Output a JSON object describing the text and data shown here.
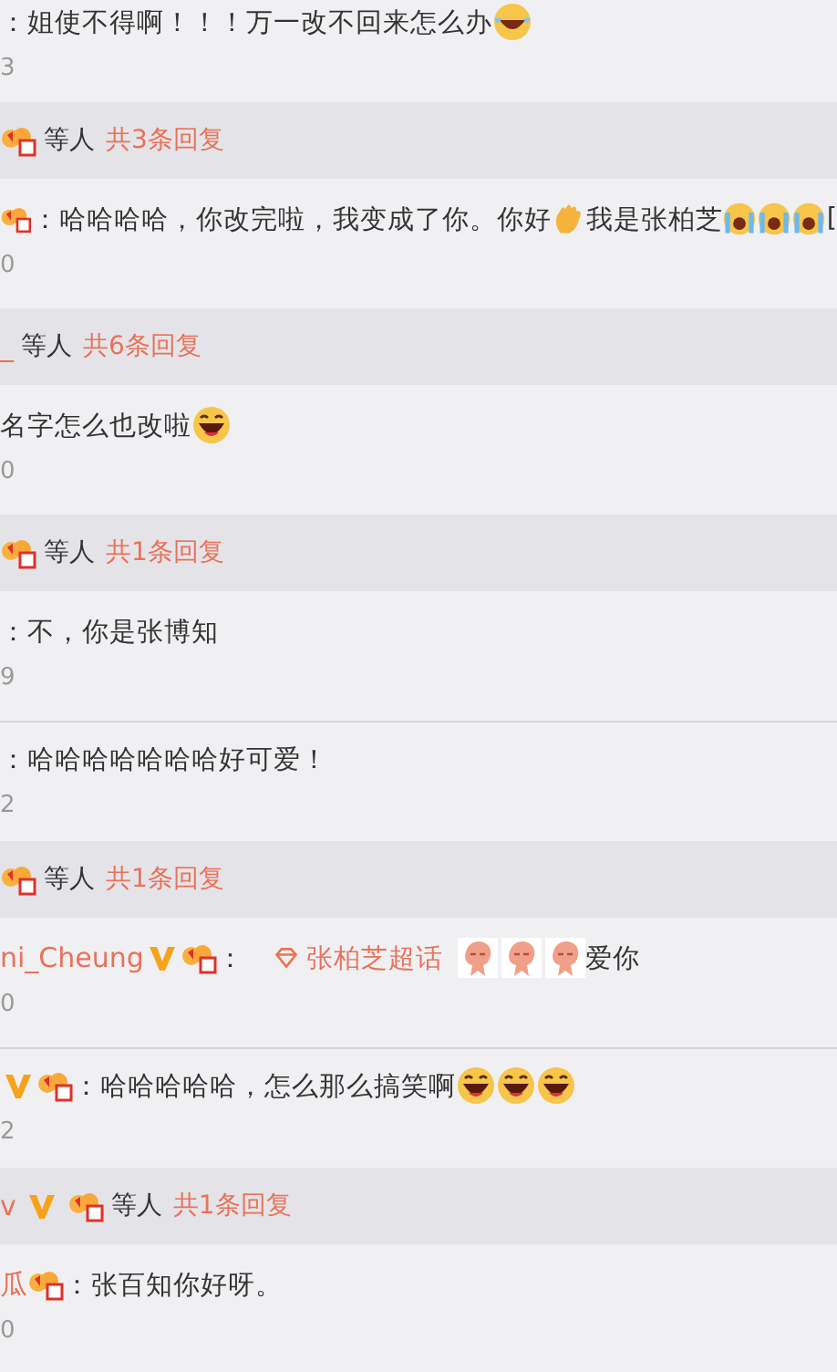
{
  "items": [
    {
      "kind": "comment",
      "segments": [
        {
          "kind": "text",
          "text": "：姐使不得啊！！！万一改不回来怎么办"
        },
        {
          "kind": "tears-emoji"
        }
      ],
      "count": "3"
    },
    {
      "kind": "summary",
      "segments": [
        {
          "kind": "badge"
        }
      ],
      "suffix": "等人",
      "replies": "共3条回复"
    },
    {
      "kind": "comment",
      "segments": [
        {
          "kind": "badge"
        },
        {
          "kind": "text",
          "text": "：哈哈哈哈，你改完啦，我变成了你。你好"
        },
        {
          "kind": "wave-emoji"
        },
        {
          "kind": "text",
          "text": "我是张柏芝"
        },
        {
          "kind": "cry-emoji"
        },
        {
          "kind": "cry-emoji"
        },
        {
          "kind": "cry-emoji"
        },
        {
          "kind": "text",
          "text": "["
        }
      ],
      "count": "0"
    },
    {
      "kind": "summary",
      "segments": [
        {
          "kind": "user",
          "text": "_"
        }
      ],
      "suffix": "等人",
      "replies": "共6条回复"
    },
    {
      "kind": "comment",
      "segments": [
        {
          "kind": "text",
          "text": "名字怎么也改啦"
        },
        {
          "kind": "laugh-emoji"
        }
      ],
      "count": "0"
    },
    {
      "kind": "summary",
      "segments": [
        {
          "kind": "badge"
        }
      ],
      "suffix": "等人",
      "replies": "共1条回复"
    },
    {
      "kind": "comment",
      "segments": [
        {
          "kind": "text",
          "text": "：不，你是张博知"
        }
      ],
      "count": "9"
    },
    {
      "kind": "comment",
      "segments": [
        {
          "kind": "text",
          "text": "：哈哈哈哈哈哈哈好可爱！"
        }
      ],
      "count": "2"
    },
    {
      "kind": "summary",
      "segments": [
        {
          "kind": "badge"
        }
      ],
      "suffix": "等人",
      "replies": "共1条回复"
    },
    {
      "kind": "comment",
      "segments": [
        {
          "kind": "user",
          "text": "ni_Cheung"
        },
        {
          "kind": "vip"
        },
        {
          "kind": "badge"
        },
        {
          "kind": "text",
          "text": "："
        },
        {
          "kind": "link",
          "text": "张柏芝超话"
        },
        {
          "kind": "sticker"
        },
        {
          "kind": "sticker"
        },
        {
          "kind": "sticker"
        },
        {
          "kind": "text",
          "text": "爱你"
        }
      ],
      "count": "0"
    },
    {
      "kind": "comment",
      "segments": [
        {
          "kind": "vip"
        },
        {
          "kind": "badge"
        },
        {
          "kind": "text",
          "text": "：哈哈哈哈哈，怎么那么搞笑啊"
        },
        {
          "kind": "laugh-emoji"
        },
        {
          "kind": "laugh-emoji"
        },
        {
          "kind": "laugh-emoji"
        }
      ],
      "count": "2"
    },
    {
      "kind": "summary",
      "segments": [
        {
          "kind": "user",
          "text": "v"
        },
        {
          "kind": "vip"
        },
        {
          "kind": "badge"
        }
      ],
      "suffix": "等人",
      "replies": "共1条回复"
    },
    {
      "kind": "comment",
      "segments": [
        {
          "kind": "user",
          "text": "瓜"
        },
        {
          "kind": "badge"
        },
        {
          "kind": "text",
          "text": "：张百知你好呀。"
        }
      ],
      "count": "0"
    }
  ]
}
